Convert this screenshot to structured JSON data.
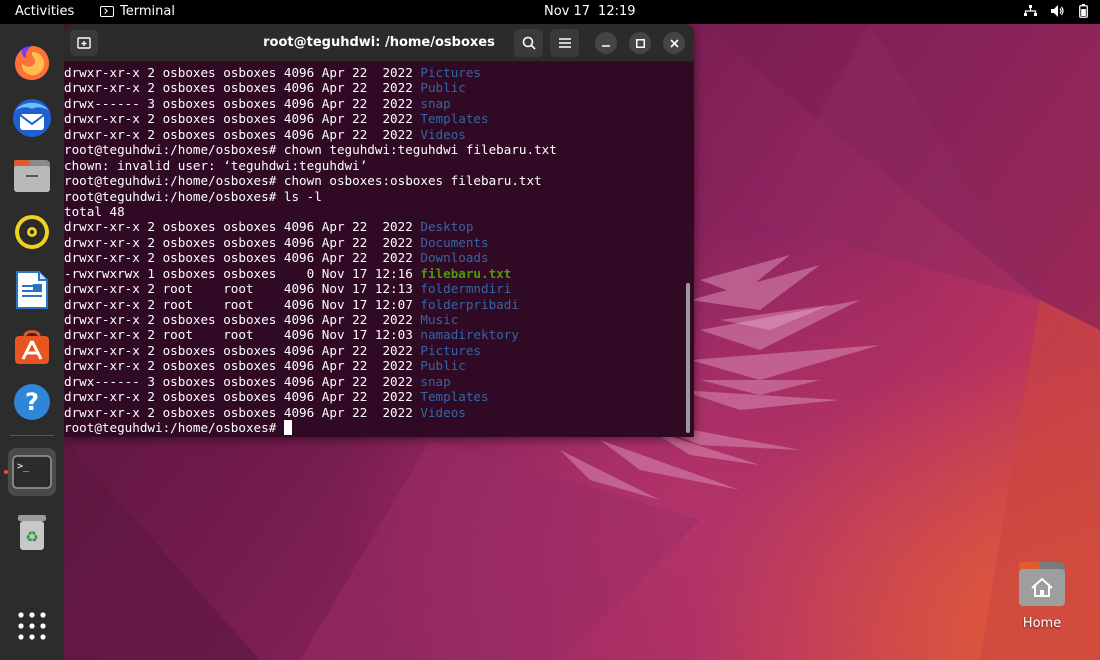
{
  "topbar": {
    "activities": "Activities",
    "app_name": "Terminal",
    "date": "Nov 17",
    "time": "12:19"
  },
  "dock": {
    "items": [
      "firefox",
      "thunderbird",
      "files",
      "rhythmbox",
      "libreoffice-writer",
      "ubuntu-software",
      "help",
      "terminal",
      "trash",
      "show-apps"
    ]
  },
  "terminal": {
    "title": "root@teguhdwi: /home/osboxes",
    "lines": [
      {
        "pre": "drwxr-xr-x 2 osboxes osboxes 4096 Apr 22  2022 ",
        "name": "Pictures",
        "kind": "dir"
      },
      {
        "pre": "drwxr-xr-x 2 osboxes osboxes 4096 Apr 22  2022 ",
        "name": "Public",
        "kind": "dir"
      },
      {
        "pre": "drwx------ 3 osboxes osboxes 4096 Apr 22  2022 ",
        "name": "snap",
        "kind": "dir"
      },
      {
        "pre": "drwxr-xr-x 2 osboxes osboxes 4096 Apr 22  2022 ",
        "name": "Templates",
        "kind": "dir"
      },
      {
        "pre": "drwxr-xr-x 2 osboxes osboxes 4096 Apr 22  2022 ",
        "name": "Videos",
        "kind": "dir"
      },
      {
        "pre": "root@teguhdwi:/home/osboxes# chown teguhdwi:teguhdwi filebaru.txt",
        "name": "",
        "kind": "text"
      },
      {
        "pre": "chown: invalid user: ‘teguhdwi:teguhdwi’",
        "name": "",
        "kind": "text"
      },
      {
        "pre": "root@teguhdwi:/home/osboxes# chown osboxes:osboxes filebaru.txt",
        "name": "",
        "kind": "text"
      },
      {
        "pre": "root@teguhdwi:/home/osboxes# ls -l",
        "name": "",
        "kind": "text"
      },
      {
        "pre": "total 48",
        "name": "",
        "kind": "text"
      },
      {
        "pre": "drwxr-xr-x 2 osboxes osboxes 4096 Apr 22  2022 ",
        "name": "Desktop",
        "kind": "dir"
      },
      {
        "pre": "drwxr-xr-x 2 osboxes osboxes 4096 Apr 22  2022 ",
        "name": "Documents",
        "kind": "dir"
      },
      {
        "pre": "drwxr-xr-x 2 osboxes osboxes 4096 Apr 22  2022 ",
        "name": "Downloads",
        "kind": "dir"
      },
      {
        "pre": "-rwxrwxrwx 1 osboxes osboxes    0 Nov 17 12:16 ",
        "name": "filebaru.txt",
        "kind": "exec"
      },
      {
        "pre": "drwxr-xr-x 2 root    root    4096 Nov 17 12:13 ",
        "name": "foldermndiri",
        "kind": "dir"
      },
      {
        "pre": "drwxr-xr-x 2 root    root    4096 Nov 17 12:07 ",
        "name": "folderpribadi",
        "kind": "dir"
      },
      {
        "pre": "drwxr-xr-x 2 osboxes osboxes 4096 Apr 22  2022 ",
        "name": "Music",
        "kind": "dir"
      },
      {
        "pre": "drwxr-xr-x 2 root    root    4096 Nov 17 12:03 ",
        "name": "namadirektory",
        "kind": "dir"
      },
      {
        "pre": "drwxr-xr-x 2 osboxes osboxes 4096 Apr 22  2022 ",
        "name": "Pictures",
        "kind": "dir"
      },
      {
        "pre": "drwxr-xr-x 2 osboxes osboxes 4096 Apr 22  2022 ",
        "name": "Public",
        "kind": "dir"
      },
      {
        "pre": "drwx------ 3 osboxes osboxes 4096 Apr 22  2022 ",
        "name": "snap",
        "kind": "dir"
      },
      {
        "pre": "drwxr-xr-x 2 osboxes osboxes 4096 Apr 22  2022 ",
        "name": "Templates",
        "kind": "dir"
      },
      {
        "pre": "drwxr-xr-x 2 osboxes osboxes 4096 Apr 22  2022 ",
        "name": "Videos",
        "kind": "dir"
      },
      {
        "pre": "root@teguhdwi:/home/osboxes# ",
        "name": "",
        "kind": "prompt"
      }
    ]
  },
  "desktop": {
    "home_label": "Home"
  },
  "colors": {
    "terminal_bg": "#300a24",
    "dir_color": "#3465a4",
    "exec_color": "#4e9a06",
    "accent": "#e95420"
  }
}
